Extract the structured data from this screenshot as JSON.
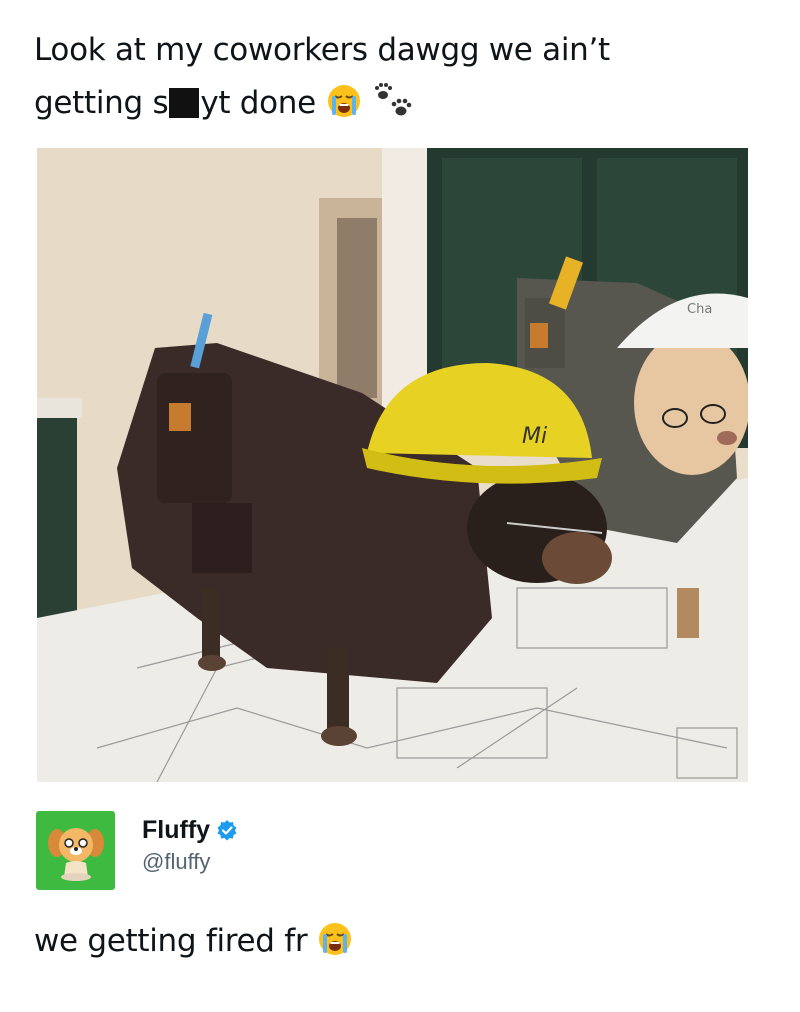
{
  "post": {
    "line1": "Look at my coworkers dawgg we ain’t",
    "line2_before": "getting s",
    "line2_after": "yt done",
    "emojis": [
      "loudly-crying-face-icon",
      "paw-prints-icon"
    ]
  },
  "photo": {
    "helmet_left_text": "Mi",
    "helmet_right_text": "Cha"
  },
  "quoted_account": {
    "display_name": "Fluffy",
    "handle": "@fluffy",
    "verified": true,
    "avatar_color": "#3dba3f",
    "verified_color": "#1d9bf0"
  },
  "reply": {
    "text": "we getting fired fr",
    "emoji": "loudly-crying-face-icon"
  }
}
